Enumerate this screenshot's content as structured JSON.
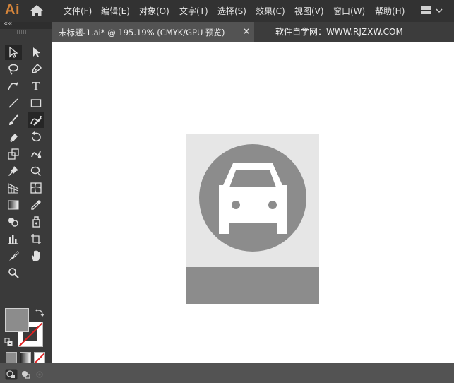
{
  "app": {
    "logo": "Ai"
  },
  "menu": [
    {
      "id": "file",
      "label": "文件(F)"
    },
    {
      "id": "edit",
      "label": "编辑(E)"
    },
    {
      "id": "object",
      "label": "对象(O)"
    },
    {
      "id": "type",
      "label": "文字(T)"
    },
    {
      "id": "select",
      "label": "选择(S)"
    },
    {
      "id": "effect",
      "label": "效果(C)"
    },
    {
      "id": "view",
      "label": "视图(V)"
    },
    {
      "id": "window",
      "label": "窗口(W)"
    },
    {
      "id": "help",
      "label": "帮助(H)"
    }
  ],
  "document": {
    "tab_title": "未标题-1.ai* @ 195.19% (CMYK/GPU 预览)",
    "close": "×"
  },
  "watermark": "软件自学网：WWW.RJZXW.COM",
  "toolbar": {
    "collapse": "««",
    "type_tool": "T",
    "selected_tool": "shaper-tool"
  },
  "colors": {
    "fill": "#8c8c8c",
    "stroke": "none",
    "artboard_bg": "#e6e6e6",
    "circle": "#8c8c8c",
    "car": "#ffffff",
    "app_logo": "#d4843a"
  }
}
